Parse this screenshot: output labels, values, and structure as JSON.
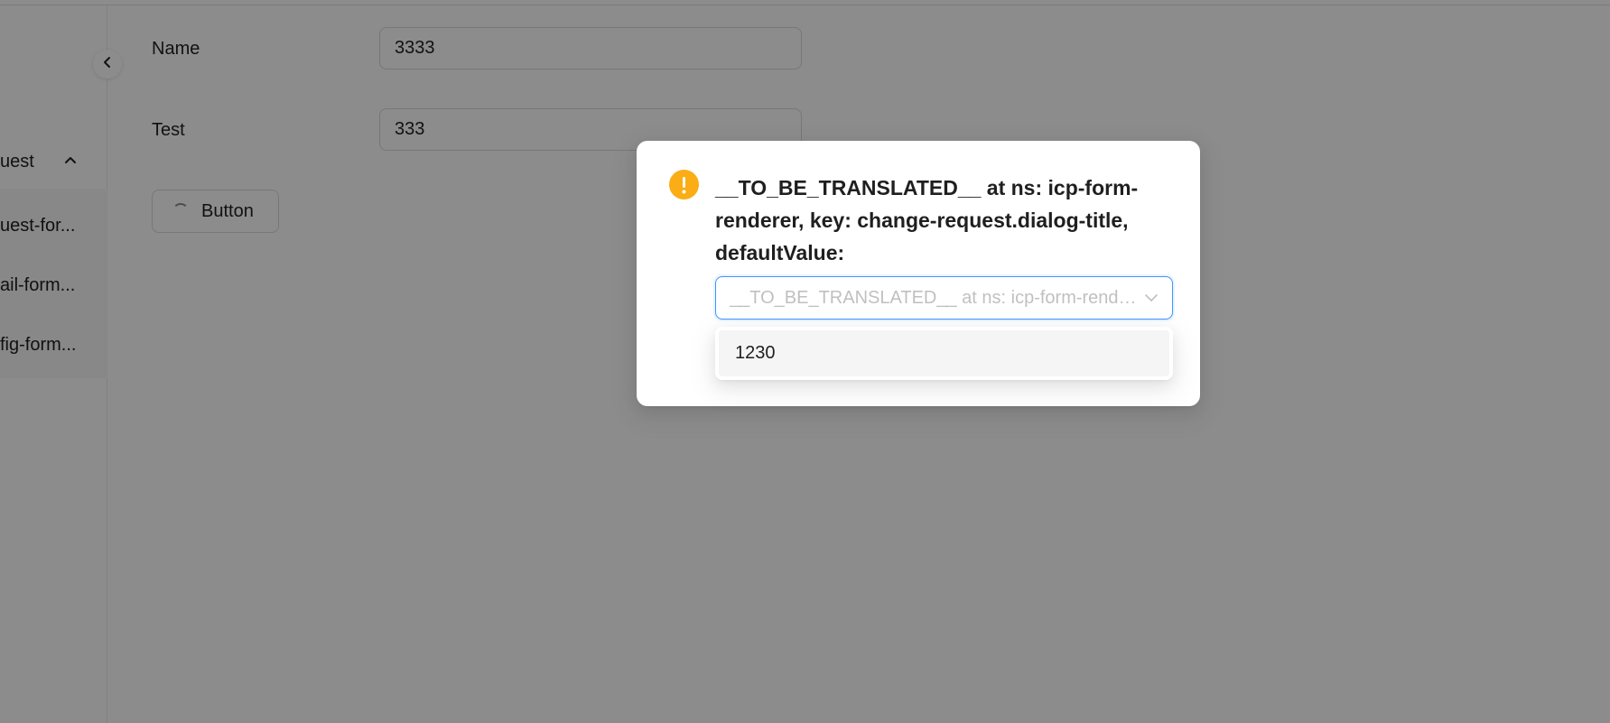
{
  "sidebar": {
    "group_label": "uest",
    "items": [
      {
        "label": "uest-for..."
      },
      {
        "label": "ail-form..."
      },
      {
        "label": "fig-form..."
      }
    ]
  },
  "form": {
    "fields": [
      {
        "label": "Name",
        "value": "3333"
      },
      {
        "label": "Test",
        "value": "333"
      }
    ],
    "button_label": "Button"
  },
  "modal": {
    "title": "__TO_BE_TRANSLATED__ at ns: icp-form-renderer, key: change-request.dialog-title, defaultValue:",
    "select_placeholder": "__TO_BE_TRANSLATED__ at ns: icp-form-renderer, key: change-request.dialog-select-placeholder",
    "options": [
      {
        "label": "1230"
      }
    ]
  },
  "colors": {
    "warning": "#faad14",
    "primary_border": "#4096ff",
    "mask": "rgba(0,0,0,0.45)"
  }
}
